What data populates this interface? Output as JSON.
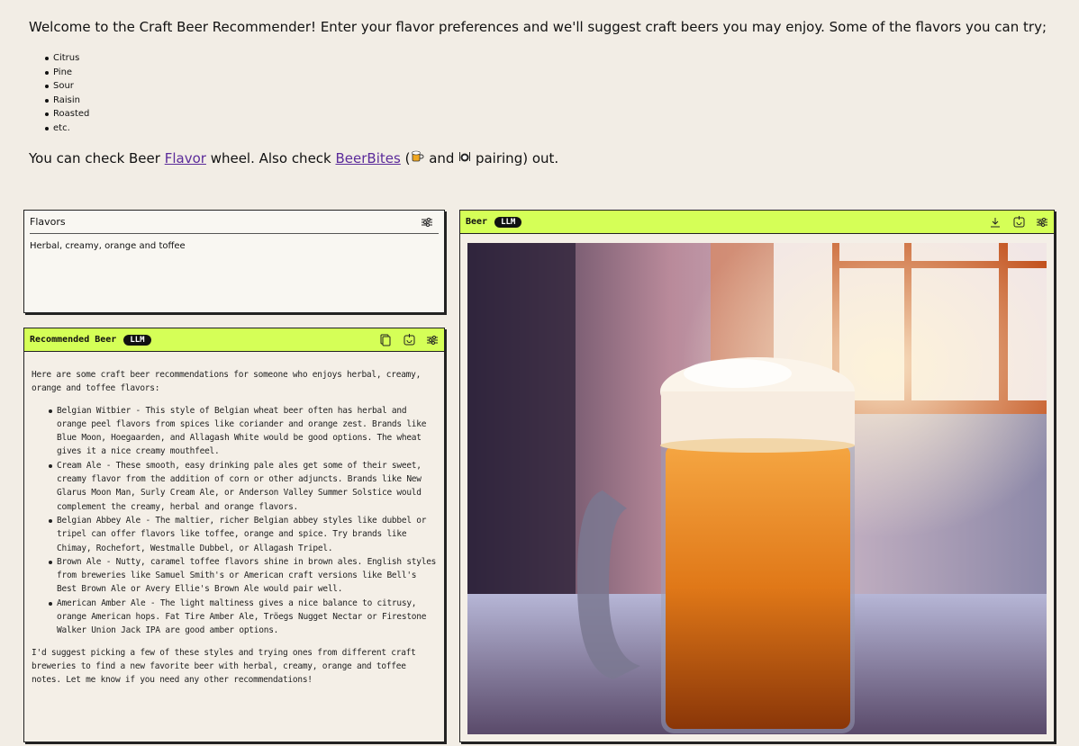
{
  "intro": {
    "welcome": "Welcome to the Craft Beer Recommender! Enter your flavor preferences and we'll suggest craft beers you may enjoy. Some of the flavors you can try;",
    "flavor_examples": [
      "Citrus",
      "Pine",
      "Sour",
      "Raisin",
      "Roasted",
      "etc."
    ],
    "check_prefix": "You can check Beer ",
    "flavor_link": "Flavor",
    "check_middle": " wheel. Also check ",
    "beerbites_link": "BeerBites",
    "pairing_open": " (",
    "pairing_and": " and ",
    "pairing_close": " pairing) out."
  },
  "flavors_panel": {
    "title": "Flavors",
    "value": "Herbal, creamy, orange and toffee"
  },
  "recommended_panel": {
    "title": "Recommended Beer",
    "badge": "LLM",
    "intro": "Here are some craft beer recommendations for someone who enjoys herbal, creamy, orange and toffee flavors:",
    "items": [
      "Belgian Witbier - This style of Belgian wheat beer often has herbal and orange peel flavors from spices like coriander and orange zest. Brands like Blue Moon, Hoegaarden, and Allagash White would be good options. The wheat gives it a nice creamy mouthfeel.",
      "Cream Ale - These smooth, easy drinking pale ales get some of their sweet, creamy flavor from the addition of corn or other adjuncts. Brands like New Glarus Moon Man, Surly Cream Ale, or Anderson Valley Summer Solstice would complement the creamy, herbal and orange flavors.",
      "Belgian Abbey Ale - The maltier, richer Belgian abbey styles like dubbel or tripel can offer flavors like toffee, orange and spice. Try brands like Chimay, Rochefort, Westmalle Dubbel, or Allagash Tripel.",
      "Brown Ale - Nutty, caramel toffee flavors shine in brown ales. English styles from breweries like Samuel Smith's or American craft versions like Bell's Best Brown Ale or Avery Ellie's Brown Ale would pair well.",
      "American Amber Ale - The light maltiness gives a nice balance to citrusy, orange American hops. Fat Tire Amber Ale, Tröegs Nugget Nectar or Firestone Walker Union Jack IPA are good amber options."
    ],
    "outro": "I'd suggest picking a few of these styles and trying ones from different craft breweries to find a new favorite beer with herbal, creamy, orange and toffee notes. Let me know if you need any other recommendations!"
  },
  "beer_panel": {
    "title": "Beer",
    "badge": "LLM"
  },
  "icons": {
    "settings": "sliders-icon",
    "copy": "copy-icon",
    "regenerate": "regenerate-icon",
    "download": "download-icon",
    "beer_emoji": "beer-mug-emoji",
    "plate_emoji": "plate-emoji"
  },
  "colors": {
    "accent": "#d5ff57",
    "background": "#f2ede5",
    "link": "#5b2b9a"
  }
}
